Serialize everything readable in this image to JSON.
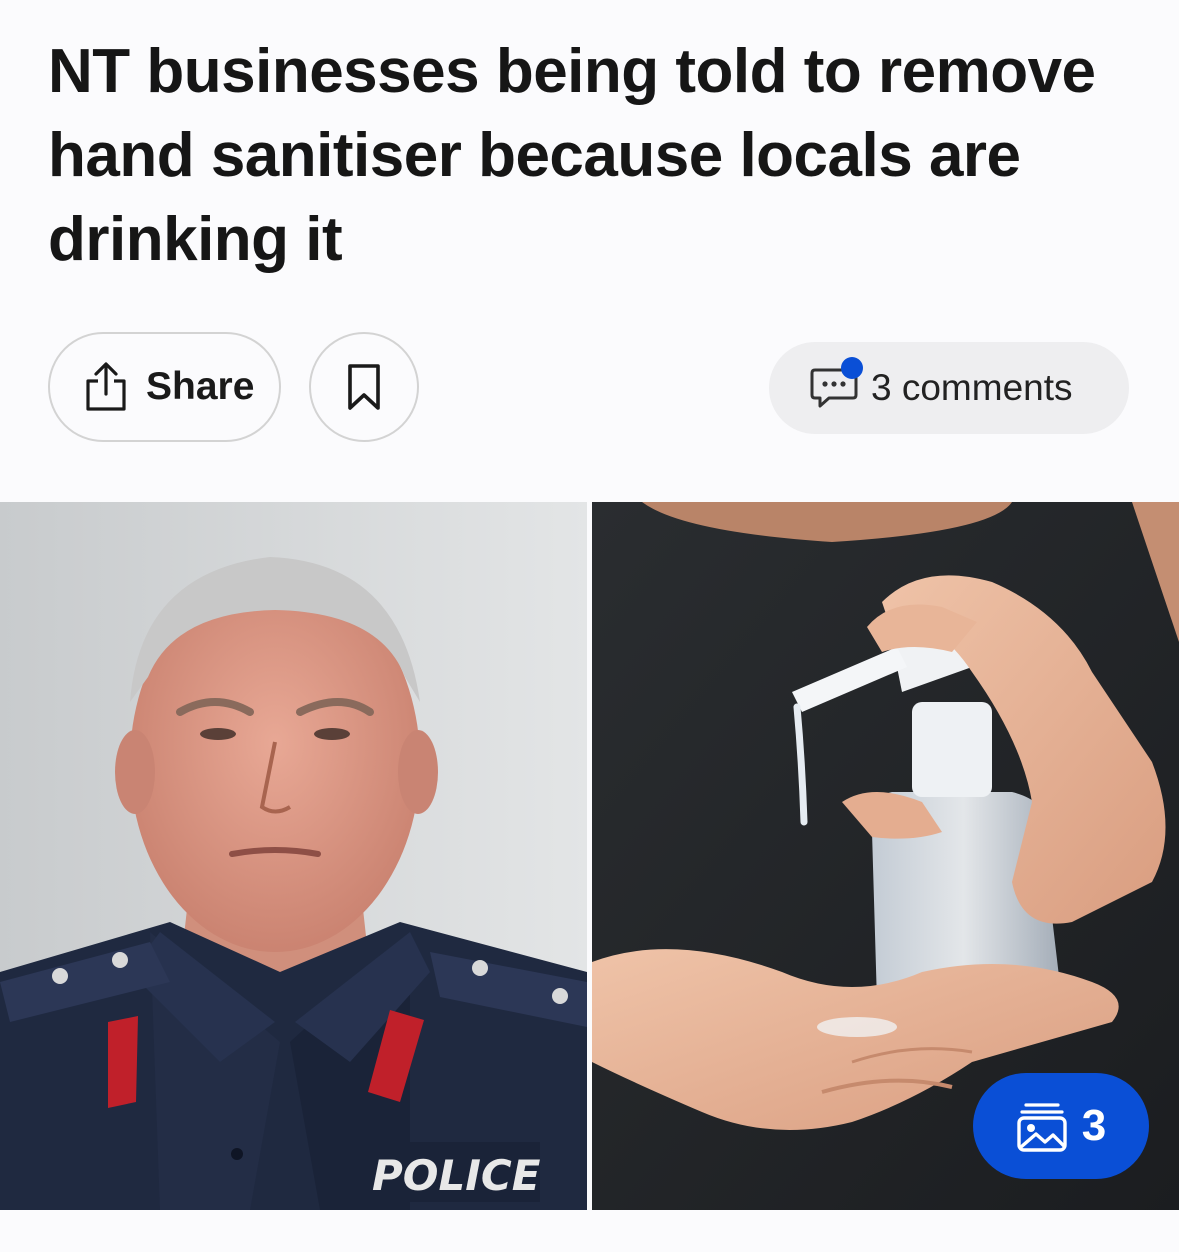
{
  "article": {
    "headline": "NT businesses being told to remove hand sanitiser because locals are drinking it"
  },
  "actions": {
    "share_label": "Share",
    "comments_label": "3 comments",
    "share_icon": "share-icon",
    "bookmark_icon": "bookmark-icon",
    "comments_icon": "comment-bubble-icon",
    "comments_unread_color": "#0a4fd6"
  },
  "gallery": {
    "count": "3",
    "icon": "image-gallery-icon",
    "badge_color": "#0a4fd6",
    "left_photo": {
      "alt": "Police commissioner in uniform",
      "uniform_text": "POLICE"
    },
    "right_photo": {
      "alt": "Hands using a hand sanitiser pump bottle"
    }
  }
}
